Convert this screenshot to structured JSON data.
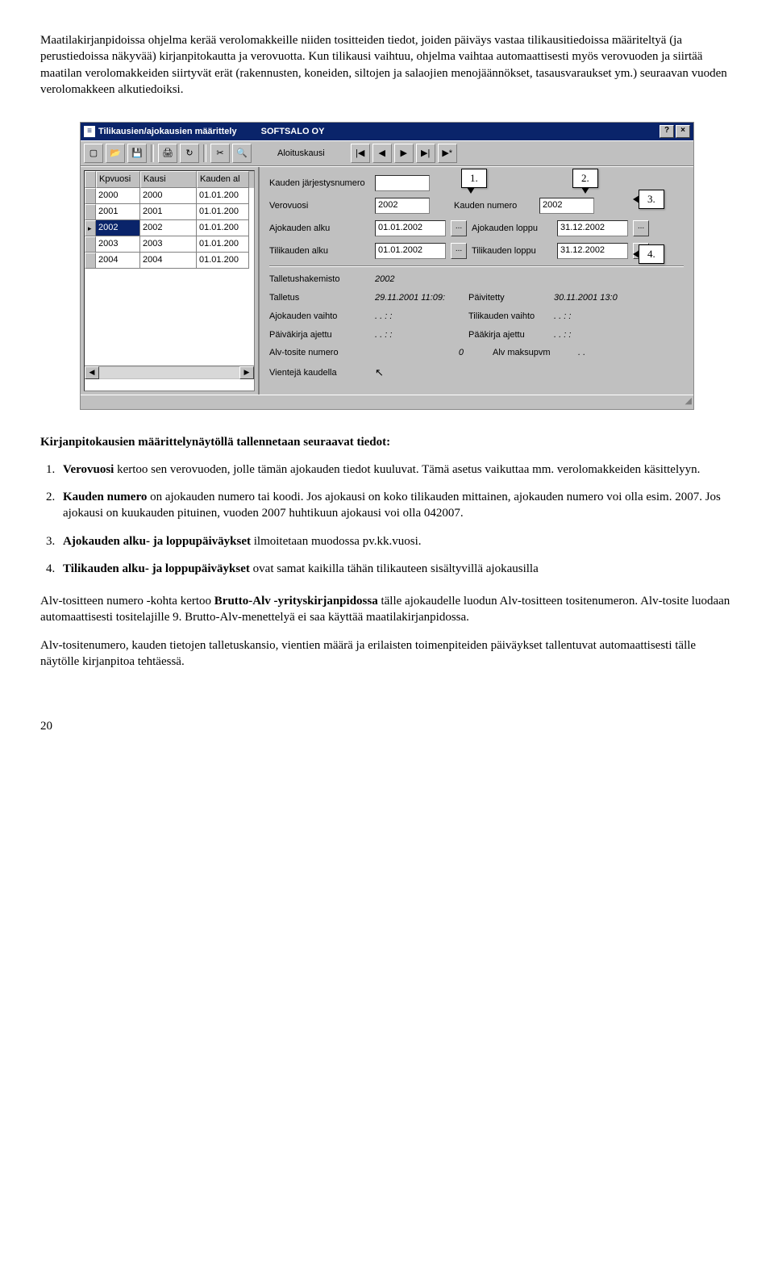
{
  "para1": "Maatilakirjanpidoissa ohjelma kerää verolomakkeille niiden tositteiden tiedot, joiden päiväys vastaa tilikausitiedoissa määriteltyä (ja perustiedoissa näkyvää) kirjanpitokautta ja verovuotta. Kun tilikausi vaihtuu, ohjelma vaihtaa automaattisesti myös verovuoden ja siirtää maatilan verolomakkeiden siirtyvät erät (rakennusten, koneiden, siltojen ja salaojien menojäännökset, tasausvaraukset ym.) seuraavan vuoden verolomakkeen alkutiedoiksi.",
  "win": {
    "title": "Tilikausien/ajokausien määrittely",
    "company": "SOFTSALO OY",
    "help": "?",
    "close": "×",
    "toolbar_label": "Aloituskausi",
    "nav_first": "|◀",
    "nav_prev": "◀",
    "nav_next": "▶",
    "nav_last": "▶|",
    "nav_new": "▶*"
  },
  "grid": {
    "h1": "Kpvuosi",
    "h2": "Kausi",
    "h3": "Kauden al",
    "rows": [
      {
        "c1": "2000",
        "c2": "2000",
        "c3": "01.01.200"
      },
      {
        "c1": "2001",
        "c2": "2001",
        "c3": "01.01.200"
      },
      {
        "c1": "2002",
        "c2": "2002",
        "c3": "01.01.200"
      },
      {
        "c1": "2003",
        "c2": "2003",
        "c3": "01.01.200"
      },
      {
        "c1": "2004",
        "c2": "2004",
        "c3": "01.01.200"
      }
    ]
  },
  "form": {
    "l_jarj": "Kauden järjestysnumero",
    "l_vero": "Verovuosi",
    "v_vero": "2002",
    "l_knum": "Kauden numero",
    "v_knum": "2002",
    "l_ajalku": "Ajokauden alku",
    "v_ajalku": "01.01.2002",
    "l_ajloppu": "Ajokauden loppu",
    "v_ajloppu": "31.12.2002",
    "l_tilalku": "Tilikauden alku",
    "v_tilalku": "01.01.2002",
    "l_tilloppu": "Tilikauden loppu",
    "v_tilloppu": "31.12.2002",
    "l_hak": "Talletushakemisto",
    "v_hak": "2002",
    "l_tall": "Talletus",
    "v_tall": "29.11.2001 11:09:",
    "l_paiv": "Päivitetty",
    "v_paiv": "30.11.2001 13:0",
    "l_ajv": "Ajokauden vaihto",
    "v_dots": ". .   : :",
    "l_tilv": "Tilikauden vaihto",
    "l_pka": "Päiväkirja ajettu",
    "l_paaka": "Pääkirja ajettu",
    "l_alvt": "Alv-tosite numero",
    "v_alvt": "0",
    "l_alvm": "Alv maksupvm",
    "v_alvm": ". .",
    "l_vient": "Vientejä kaudella",
    "dotbtn": "..."
  },
  "callouts": {
    "c1": "1.",
    "c2": "2.",
    "c3": "3.",
    "c4": "4."
  },
  "section_head": "Kirjanpitokausien määrittelynäytöllä tallennetaan seuraavat tiedot:",
  "list": {
    "i1a": "Verovuosi",
    "i1b": " kertoo sen verovuoden, jolle tämän ajokauden tiedot kuuluvat. Tämä asetus vaikuttaa mm. verolomakkeiden käsittelyyn.",
    "i2a": "Kauden numero",
    "i2b": " on ajokauden numero tai koodi. Jos ajokausi on koko tilikauden mittainen, ajokauden numero voi olla esim. 2007. Jos ajokausi on kuukauden pituinen, vuoden 2007 huhtikuun ajokausi voi olla 042007.",
    "i3a": "Ajokauden alku- ja loppupäiväykset",
    "i3b": " ilmoitetaan muodossa pv.kk.vuosi.",
    "i4a": "Tilikauden alku- ja loppupäiväykset",
    "i4b": " ovat samat kaikilla tähän tilikauteen sisältyvillä ajokausilla"
  },
  "para2a": "Alv-tositteen numero -kohta kertoo ",
  "para2b": "Brutto-Alv -yrityskirjanpidossa",
  "para2c": " tälle ajokaudelle luodun Alv-tositteen tositenumeron. Alv-tosite luodaan automaattisesti tositelajille 9. Brutto-Alv-menettelyä ei saa käyttää maatilakirjanpidossa.",
  "para3": "Alv-tositenumero, kauden tietojen talletuskansio, vientien määrä ja erilaisten toimenpiteiden päiväykset tallentuvat automaattisesti tälle näytölle kirjanpitoa tehtäessä.",
  "pagenum": "20"
}
